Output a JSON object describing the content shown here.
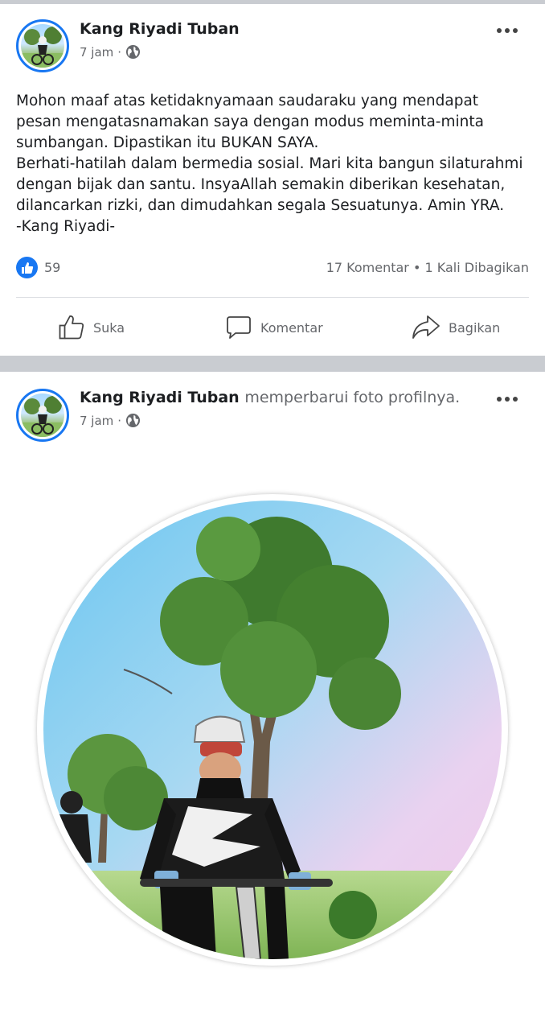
{
  "posts": [
    {
      "author": "Kang Riyadi Tuban",
      "time": "7 jam",
      "separator": "·",
      "privacy_icon": "globe-icon",
      "more_icon": "more-options-icon",
      "text": "Mohon maaf atas ketidaknyamaan saudaraku yang mendapat\npesan mengatasnamakan saya dengan modus meminta-minta\nsumbangan. Dipastikan itu BUKAN SAYA.\nBerhati-hatilah dalam bermedia sosial. Mari kita bangun silaturahmi\ndengan bijak dan santu. InsyaAllah semakin diberikan kesehatan,\ndilancarkan rizki, dan dimudahkan segala Sesuatunya. Amin YRA.\n-Kang Riyadi-",
      "reaction_icon": "like-icon",
      "reaction_count": "59",
      "counts_text": "17 Komentar • 1 Kali Dibagikan",
      "actions": {
        "like_label": "Suka",
        "comment_label": "Komentar",
        "share_label": "Bagikan"
      }
    },
    {
      "author": "Kang Riyadi Tuban",
      "action_text": "memperbarui foto profilnya.",
      "time": "7 jam",
      "separator": "·",
      "privacy_icon": "globe-icon",
      "more_icon": "more-options-icon"
    }
  ],
  "colors": {
    "accent": "#1877f2",
    "separator": "#c9ccd1",
    "secondary_text": "#65676b"
  }
}
